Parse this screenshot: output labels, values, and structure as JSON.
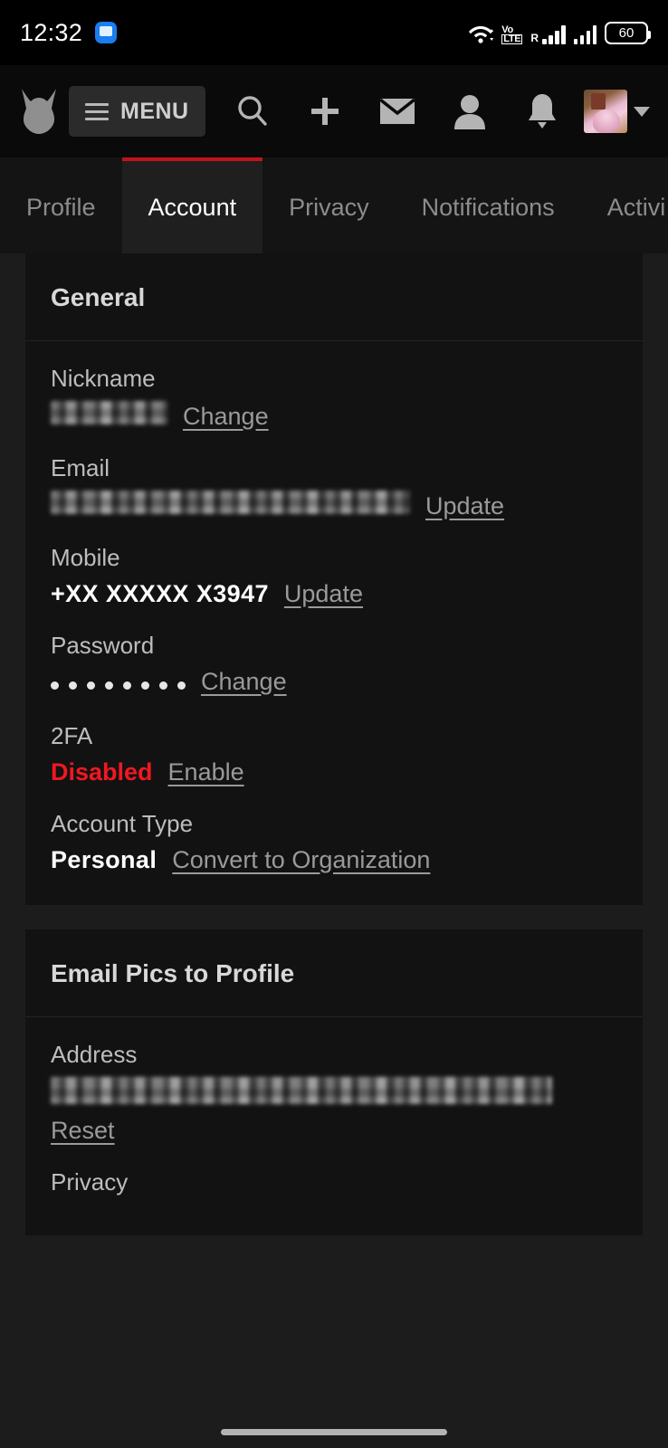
{
  "statusbar": {
    "time": "12:32",
    "chat_icon": "chat-bubble-icon",
    "wifi_icon": "wifi-icon",
    "volte_line1": "Vo",
    "volte_line2": "LTE",
    "roaming_label": "R",
    "signal_icon": "signal-bars-icon",
    "battery_level": "60",
    "battery_icon": "battery-icon"
  },
  "navbar": {
    "logo": "fetlife-logo",
    "menu_label": "MENU",
    "menu_icon": "hamburger-icon",
    "icons": [
      {
        "name": "search-icon",
        "glyph": "search"
      },
      {
        "name": "plus-icon",
        "glyph": "plus"
      },
      {
        "name": "mail-icon",
        "glyph": "envelope"
      },
      {
        "name": "person-icon",
        "glyph": "person"
      },
      {
        "name": "bell-icon",
        "glyph": "bell"
      }
    ],
    "avatar_alt": "user-avatar",
    "caret_icon": "chevron-down-icon"
  },
  "tabs": [
    {
      "label": "Profile",
      "active": false
    },
    {
      "label": "Account",
      "active": true
    },
    {
      "label": "Privacy",
      "active": false
    },
    {
      "label": "Notifications",
      "active": false
    },
    {
      "label": "Activi",
      "active": false
    }
  ],
  "accent_color": "#c4121c",
  "danger_color": "#ef1822",
  "sections": [
    {
      "title": "General",
      "rows": [
        {
          "label": "Nickname",
          "value": "",
          "redacted": true,
          "link": "Change"
        },
        {
          "label": "Email",
          "value": "",
          "redacted": true,
          "link": "Update"
        },
        {
          "label": "Mobile",
          "value": "+XX XXXXX X3947",
          "redacted": false,
          "link": "Update"
        },
        {
          "label": "Password",
          "value": "••••••••",
          "redacted": false,
          "link": "Change",
          "dots": 8
        },
        {
          "label": "2FA",
          "value": "Disabled",
          "redacted": false,
          "link": "Enable",
          "danger": true
        },
        {
          "label": "Account Type",
          "value": "Personal",
          "redacted": false,
          "link": "Convert to Organization"
        }
      ]
    },
    {
      "title": "Email Pics to Profile",
      "rows": [
        {
          "label": "Address",
          "value": "",
          "redacted": true,
          "link": "Reset"
        },
        {
          "label": "Privacy",
          "value": "",
          "redacted": false,
          "link": ""
        }
      ]
    }
  ]
}
